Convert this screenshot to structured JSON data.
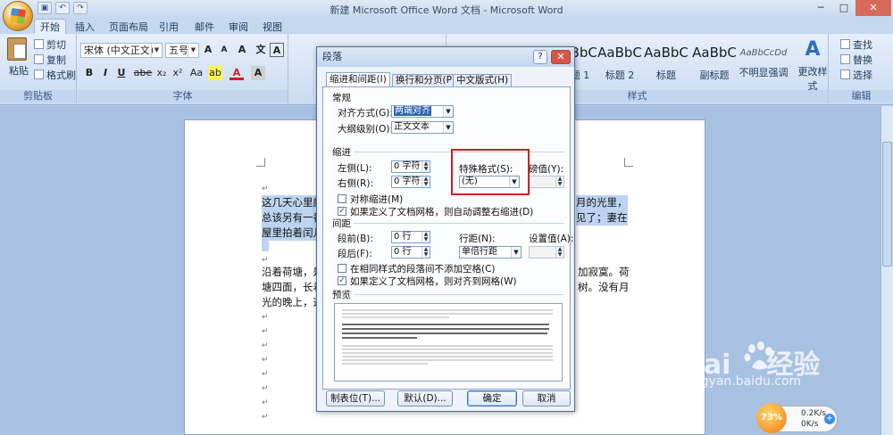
{
  "window": {
    "title": "新建 Microsoft Office Word 文档 - Microsoft Word",
    "controls": [
      "─",
      "□",
      "✕"
    ]
  },
  "tabs": [
    "开始",
    "插入",
    "页面布局",
    "引用",
    "邮件",
    "审阅",
    "视图"
  ],
  "ribbon": {
    "clipboard": {
      "paste": "粘贴",
      "cut": "剪切",
      "copy": "复制",
      "format_painter": "格式刷",
      "label": "剪贴板"
    },
    "font": {
      "name": "宋体 (中文正文)",
      "size": "五号",
      "label": "字体",
      "grow": "A",
      "shrink": "A",
      "clear": "A",
      "bold": "B",
      "italic": "I",
      "underline": "U",
      "strike": "abe",
      "sub": "x₂",
      "sup": "x²",
      "case": "Aa",
      "highlight": "ab",
      "color": "A",
      "wen": "文",
      "a_box": "A",
      "a_char": "A"
    },
    "styles": {
      "label": "样式",
      "items": [
        {
          "sample": "AaBbC",
          "name": "标题 1"
        },
        {
          "sample": "AaBbC",
          "name": "标题 2"
        },
        {
          "sample": "AaBbC",
          "name": "标题"
        },
        {
          "sample": "AaBbC",
          "name": "副标题"
        },
        {
          "sample": "AaBbCcDd",
          "name": "不明显强调"
        }
      ],
      "change": "更改样式",
      "change_icon": "A"
    },
    "editing": {
      "find": "查找",
      "replace": "替换",
      "select": "选择",
      "label": "编辑"
    }
  },
  "document": {
    "para1_lines": [
      "这几天心里颇",
      "总该另有一番",
      "屋里拍着闰儿"
    ],
    "para1_right": [
      "月的光里，",
      "见了；妻在"
    ],
    "para2_lines": [
      "沿着荷塘，是",
      "塘四面，长着",
      "光的晚上，这"
    ],
    "para2_right": [
      "加寂寞。荷",
      "树。没有月"
    ],
    "return_mark": "↵"
  },
  "dialog": {
    "title": "段落",
    "help": "?",
    "close": "✕",
    "tabs": [
      "缩进和间距(I)",
      "换行和分页(P)",
      "中文版式(H)"
    ],
    "general": {
      "header": "常规",
      "alignment_label": "对齐方式(G):",
      "alignment_value": "两端对齐",
      "outline_label": "大纲级别(O):",
      "outline_value": "正文文本"
    },
    "indent": {
      "header": "缩进",
      "left_label": "左侧(L):",
      "left_value": "0 字符",
      "right_label": "右侧(R):",
      "right_value": "0 字符",
      "special_label": "特殊格式(S):",
      "special_value": "(无)",
      "by_label": "磅值(Y):",
      "mirror_label": "对称缩进(M)",
      "auto_adjust_label": "如果定义了文档网格，则自动调整右缩进(D)"
    },
    "spacing": {
      "header": "间距",
      "before_label": "段前(B):",
      "before_value": "0 行",
      "after_label": "段后(F):",
      "after_value": "0 行",
      "line_label": "行距(N):",
      "line_value": "单倍行距",
      "at_label": "设置值(A):",
      "no_space_label": "在相同样式的段落间不添加空格(C)",
      "snap_grid_label": "如果定义了文档网格，则对齐到网格(W)"
    },
    "preview": {
      "header": "预览"
    },
    "buttons": {
      "tabs": "制表位(T)...",
      "default": "默认(D)...",
      "ok": "确定",
      "cancel": "取消"
    }
  },
  "watermark": {
    "brand": "Bai",
    "brand2": "经验",
    "site": "jingyan.baidu.com"
  },
  "netmon": {
    "percent": "73%",
    "up": "0.2K/s",
    "down": "0K/s",
    "plus": "+"
  },
  "colors": {
    "highlight_box": "#d01f1f",
    "ribbon_bg": "#d5e3f5",
    "selection": "#2f63b6"
  }
}
